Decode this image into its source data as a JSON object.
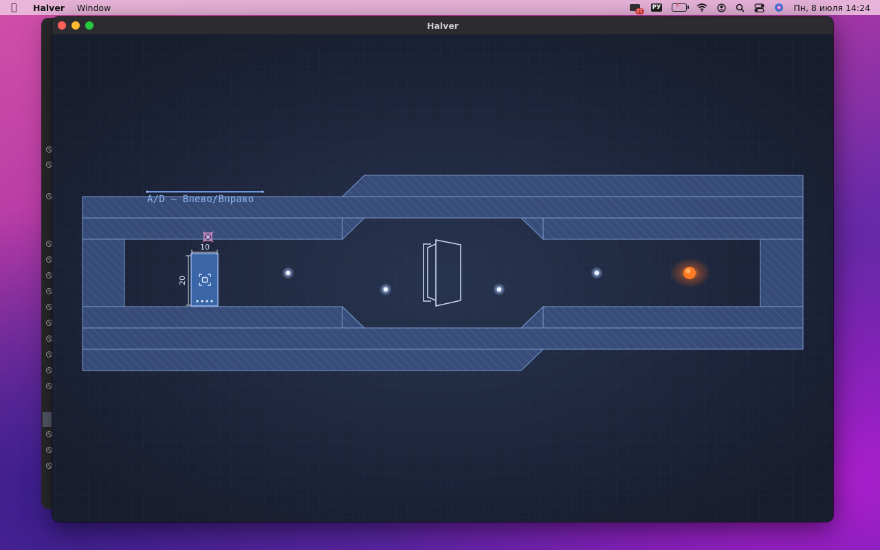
{
  "menubar": {
    "app_name": "Halver",
    "menu_items": [
      "Window"
    ],
    "notification_count": "21",
    "input_language": "РУ",
    "clock": "Пн, 8 июля  14:24"
  },
  "window": {
    "title": "Halver"
  },
  "game": {
    "control_hint": "A/D — Влево/Вправо",
    "player": {
      "width_label": "10",
      "height_label": "20"
    },
    "colors": {
      "background": "#1c2338",
      "wall_fill": "#3f5a8f",
      "wall_stroke": "#7d9ad0",
      "accent": "#8fb4ef",
      "orb": "#ff7a22"
    }
  }
}
